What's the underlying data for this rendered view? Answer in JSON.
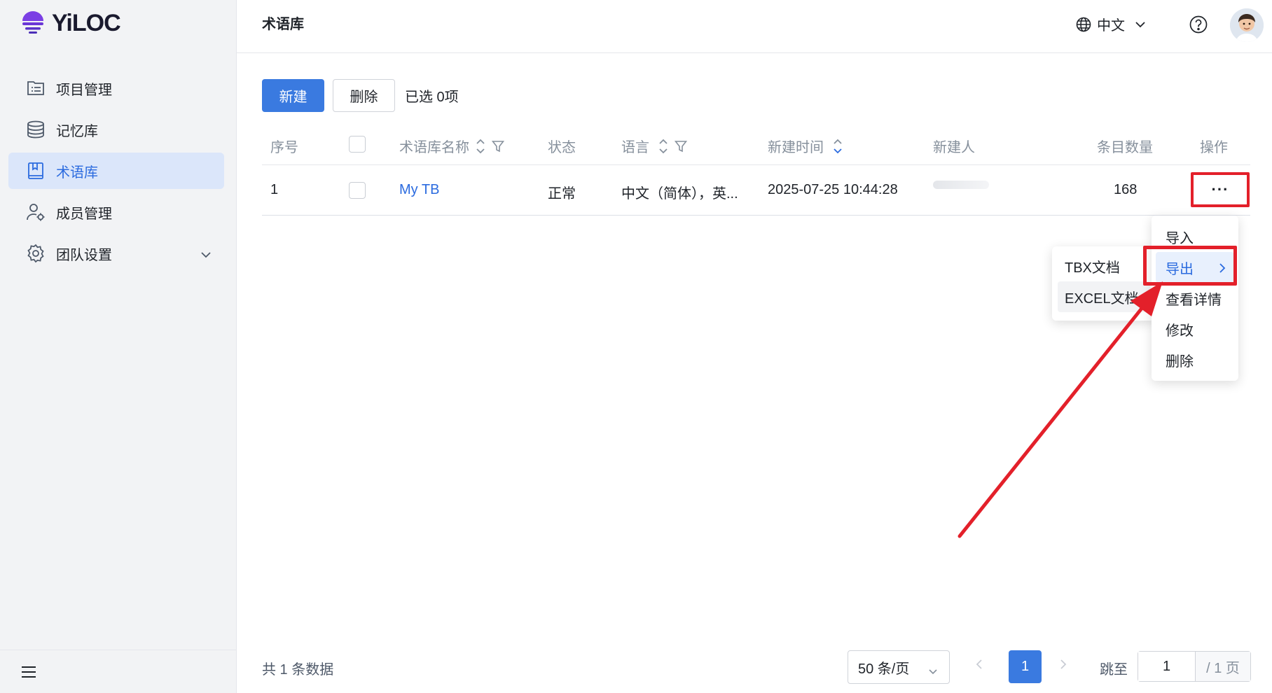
{
  "app": {
    "logo_text": "YiLOC"
  },
  "sidebar": {
    "items": [
      {
        "label": "项目管理",
        "icon": "project-list-icon"
      },
      {
        "label": "记忆库",
        "icon": "database-icon"
      },
      {
        "label": "术语库",
        "icon": "book-icon",
        "active": true
      },
      {
        "label": "成员管理",
        "icon": "member-settings-icon"
      },
      {
        "label": "团队设置",
        "icon": "gear-icon",
        "expandable": true
      }
    ]
  },
  "header": {
    "title": "术语库",
    "language": "中文"
  },
  "toolbar": {
    "new_label": "新建",
    "delete_label": "删除",
    "selected_text": "已选 0项"
  },
  "table": {
    "columns": {
      "index": "序号",
      "name": "术语库名称",
      "status": "状态",
      "language": "语言",
      "created_at": "新建时间",
      "creator": "新建人",
      "entries": "条目数量",
      "actions": "操作"
    },
    "rows": [
      {
        "index": "1",
        "name": "My TB",
        "status": "正常",
        "language": "中文（简体），英...",
        "created_at": "2025-07-25 10:44:28",
        "creator": "",
        "entries": "168",
        "actions_label": "···"
      }
    ]
  },
  "action_menu": {
    "items": [
      "导入",
      "导出",
      "查看详情",
      "修改",
      "删除"
    ],
    "highlighted": "导出"
  },
  "export_submenu": {
    "items": [
      "TBX文档",
      "EXCEL文档"
    ]
  },
  "footer": {
    "total_text": "共 1 条数据",
    "page_size": "50 条/页",
    "current_page": "1",
    "jump_label": "跳至",
    "jump_value": "1",
    "total_pages": "/ 1 页"
  },
  "colors": {
    "accent": "#3a7ae0",
    "link": "#2b6bdf",
    "annotation_red": "#e3202a"
  }
}
